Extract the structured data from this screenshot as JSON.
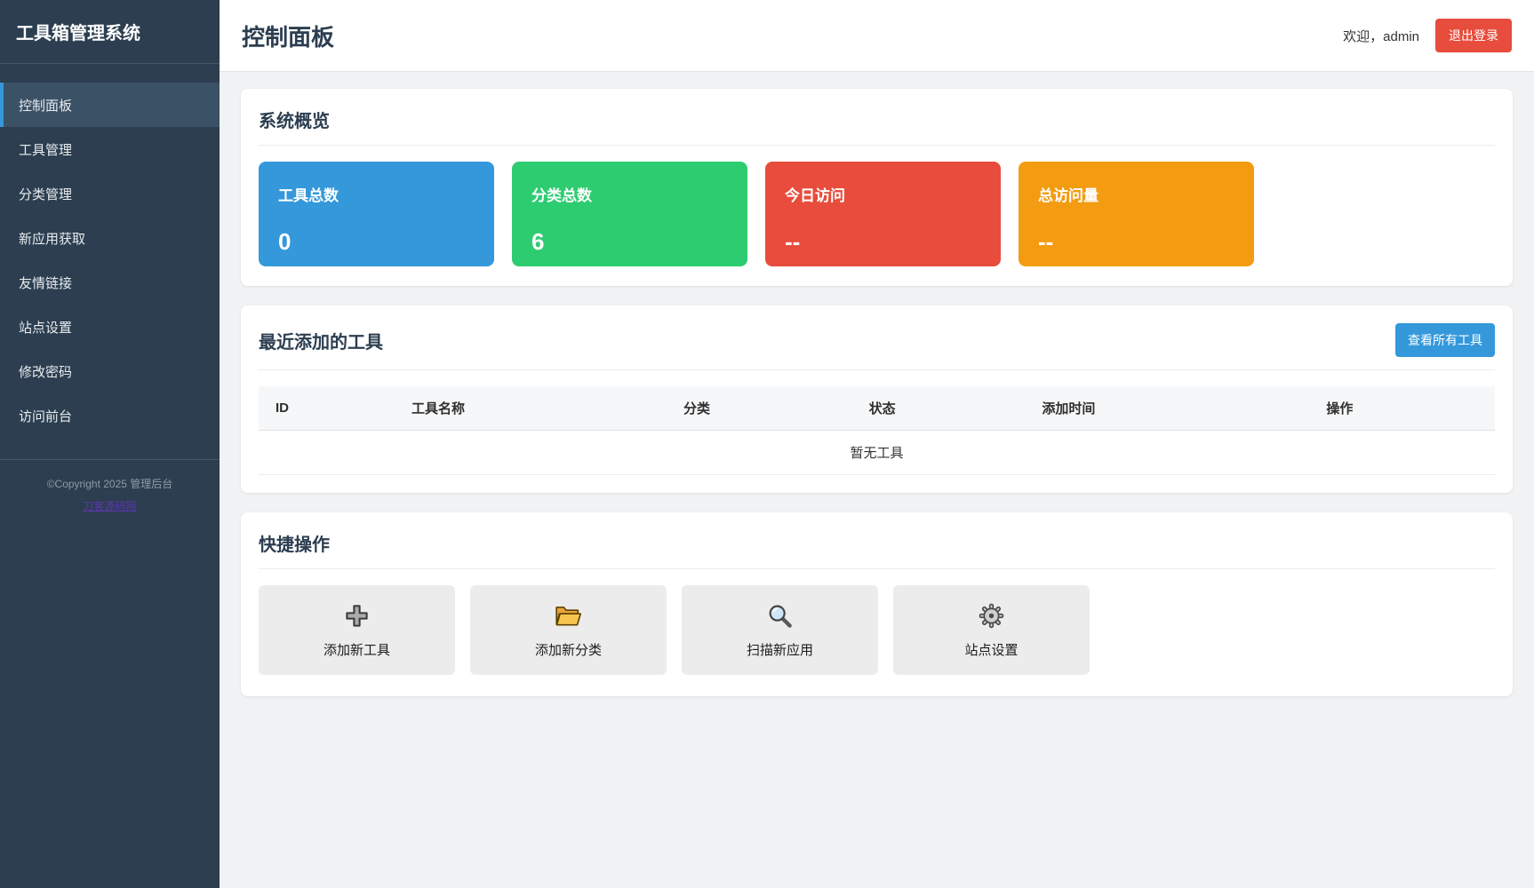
{
  "app": {
    "title": "工具箱管理系统"
  },
  "sidebar": {
    "items": [
      {
        "label": "控制面板"
      },
      {
        "label": "工具管理"
      },
      {
        "label": "分类管理"
      },
      {
        "label": "新应用获取"
      },
      {
        "label": "友情链接"
      },
      {
        "label": "站点设置"
      },
      {
        "label": "修改密码"
      },
      {
        "label": "访问前台"
      }
    ],
    "copyright": "©Copyright 2025 管理后台",
    "footer_link": "刀客源码网"
  },
  "header": {
    "title": "控制面板",
    "welcome": "欢迎，admin",
    "logout_label": "退出登录"
  },
  "overview": {
    "title": "系统概览",
    "stats": [
      {
        "label": "工具总数",
        "value": "0",
        "color": "#3498db"
      },
      {
        "label": "分类总数",
        "value": "6",
        "color": "#2ecc71"
      },
      {
        "label": "今日访问",
        "value": "--",
        "color": "#e74c3c"
      },
      {
        "label": "总访问量",
        "value": "--",
        "color": "#f39c12"
      }
    ]
  },
  "recent_tools": {
    "title": "最近添加的工具",
    "view_all_label": "查看所有工具",
    "columns": [
      "ID",
      "工具名称",
      "分类",
      "状态",
      "添加时间",
      "操作"
    ],
    "empty_text": "暂无工具"
  },
  "quick_actions": {
    "title": "快捷操作",
    "actions": [
      {
        "label": "添加新工具",
        "icon": "plus-icon"
      },
      {
        "label": "添加新分类",
        "icon": "folder-icon"
      },
      {
        "label": "扫描新应用",
        "icon": "search-icon"
      },
      {
        "label": "站点设置",
        "icon": "gear-icon"
      }
    ]
  },
  "colors": {
    "sidebar_bg": "#2c3e50",
    "accent_blue": "#3498db",
    "danger_red": "#e74c3c",
    "success_green": "#2ecc71",
    "warning_orange": "#f39c12"
  }
}
